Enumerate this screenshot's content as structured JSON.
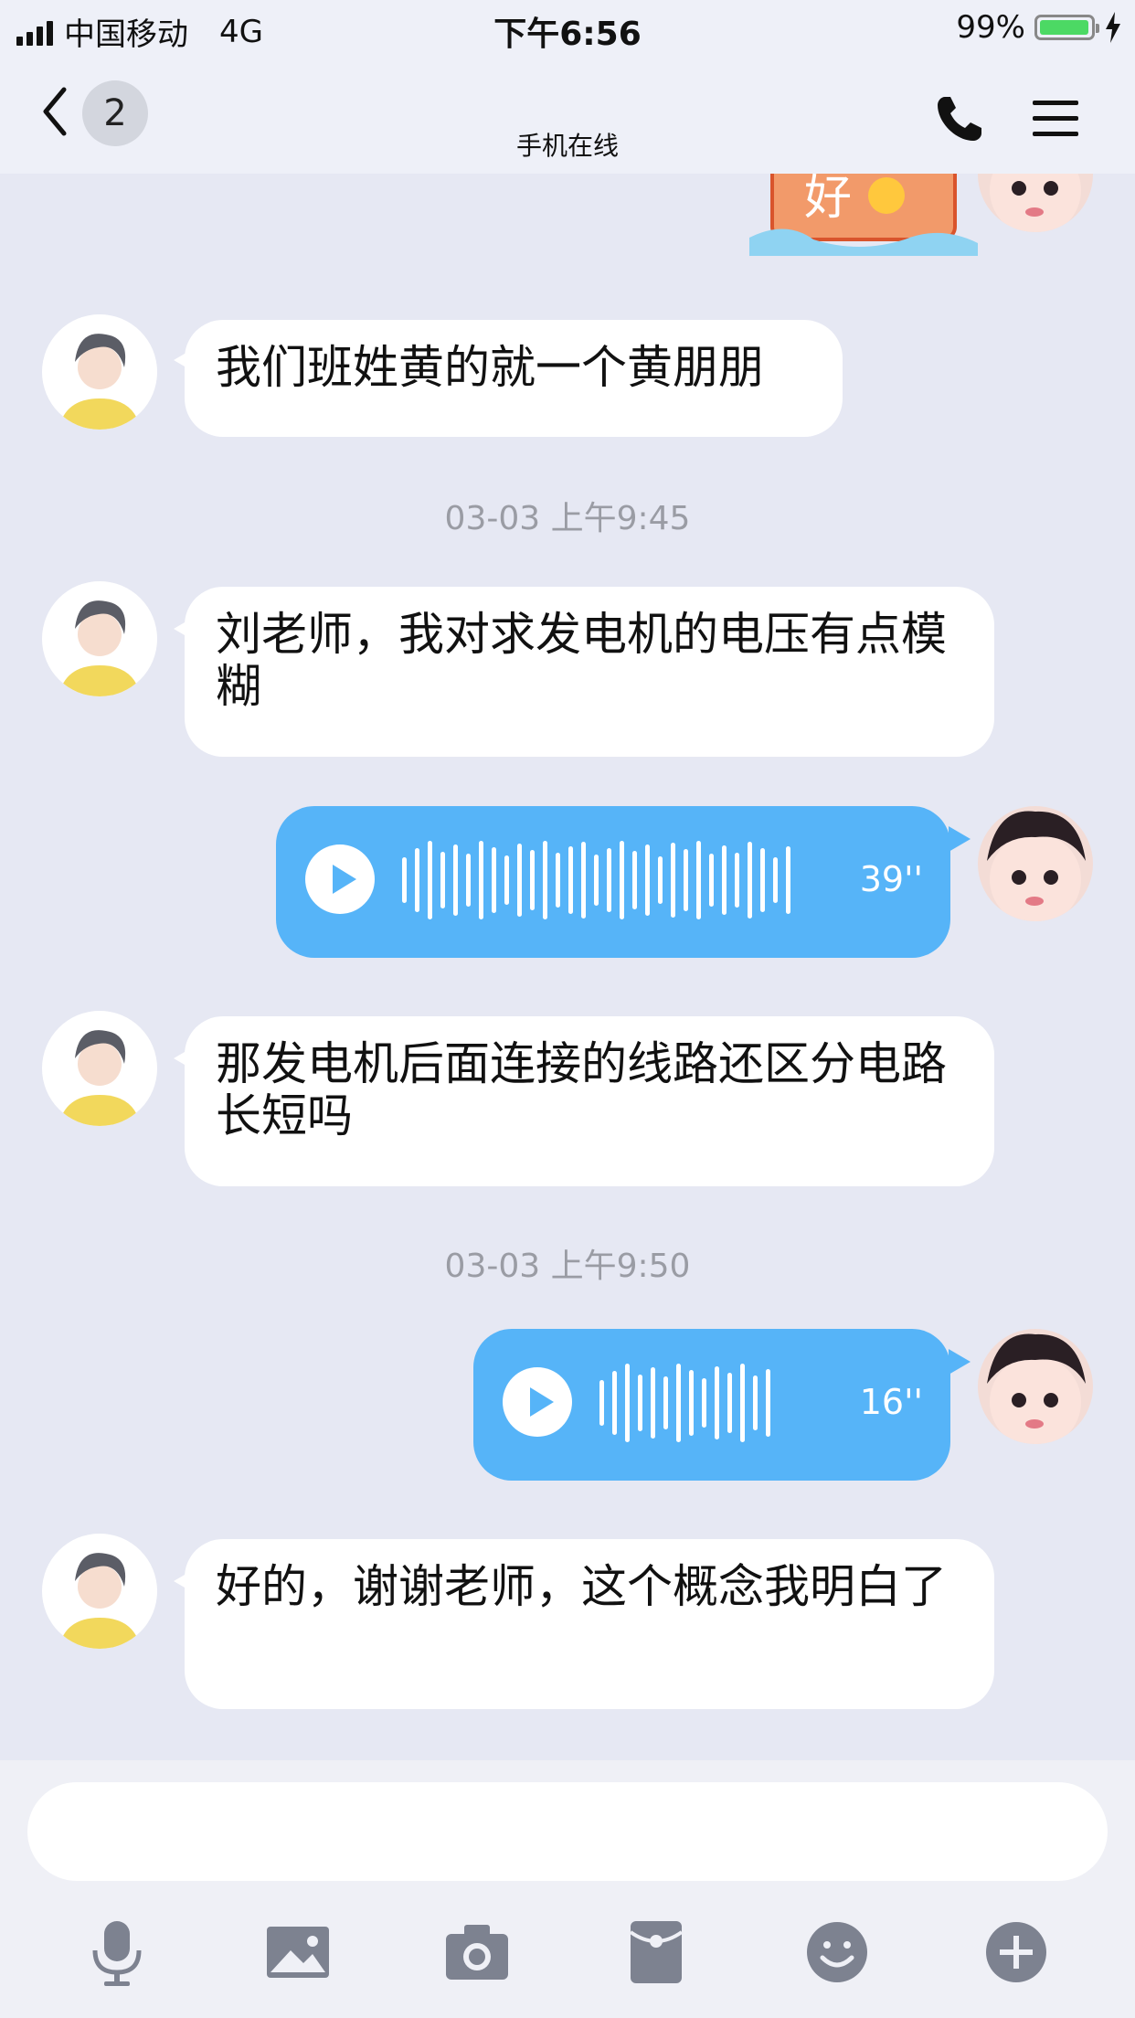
{
  "status_bar": {
    "carrier": "中国移动",
    "network": "4G",
    "time": "下午6:56",
    "battery": "99%",
    "battery_level": 0.99
  },
  "nav": {
    "unread_count": "2",
    "subtitle": "手机在线"
  },
  "sticker_text": "好",
  "messages": [
    {
      "text": "我们班姓黄的就一个黄朋朋"
    },
    {
      "text": "刘老师，我对求发电机的电压有点模糊"
    },
    {
      "duration": "39''"
    },
    {
      "text": "那发电机后面连接的线路还区分电路长短吗"
    },
    {
      "duration": "16''"
    },
    {
      "text": "好的，谢谢老师，这个概念我明白了"
    }
  ],
  "timestamps": [
    "03-03 上午9:45",
    "03-03 上午9:50"
  ],
  "input": {
    "placeholder": ""
  },
  "colors": {
    "accent": "#56b4f8",
    "background": "#e6e8f3",
    "bubble": "#ffffff"
  },
  "toolbar": [
    "microphone-icon",
    "image-icon",
    "camera-icon",
    "red-packet-icon",
    "emoji-icon",
    "plus-icon"
  ]
}
